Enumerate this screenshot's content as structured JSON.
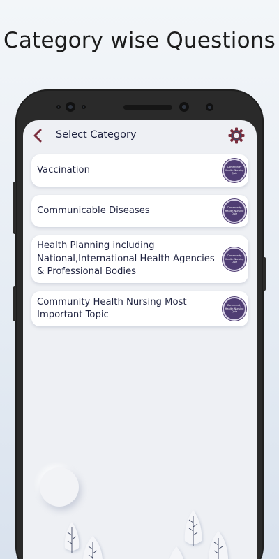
{
  "promo": {
    "title": "Category wise Questions"
  },
  "appbar": {
    "back_icon": "chevron-left-icon",
    "title": "Select Category",
    "settings_icon": "gear-icon",
    "accent": "#7a2e3d"
  },
  "badge": {
    "text": "Community Health Nursing Quiz",
    "color": "#4f3d73"
  },
  "categories": [
    {
      "label": "Vaccination"
    },
    {
      "label": "Communicable Diseases"
    },
    {
      "label": "Health Planning including National,International Health Agencies & Professional Bodies"
    },
    {
      "label": "Community Health Nursing Most Important Topic"
    }
  ]
}
